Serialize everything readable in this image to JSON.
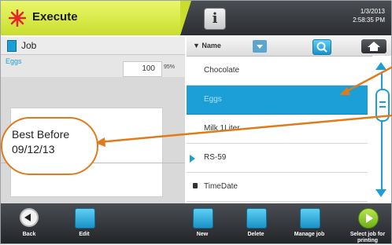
{
  "header": {
    "title": "Execute",
    "date": "1/3/2013",
    "time": "2:58:35 PM"
  },
  "left_panel": {
    "header_label": "Job",
    "job_name": "Eggs",
    "count": "100",
    "percent": "95%"
  },
  "callout": {
    "line1": "Best Before",
    "line2": "09/12/13"
  },
  "list": {
    "header_label": "▼ Name",
    "items": [
      {
        "label": "Chocolate"
      },
      {
        "label": "Eggs"
      },
      {
        "label": "Milk 1Liter"
      },
      {
        "label": "RS-59"
      },
      {
        "label": "TimeDate"
      }
    ]
  },
  "toolbar": {
    "back": "Back",
    "edit": "Edit",
    "new": "New",
    "delete": "Delete",
    "manage": "Manage job",
    "select": "Select job for printing"
  },
  "colors": {
    "accent": "#1c9fd6",
    "title_bg": "#d9ec45",
    "callout": "#e07b1b",
    "select_icon": "#8cc63f"
  }
}
